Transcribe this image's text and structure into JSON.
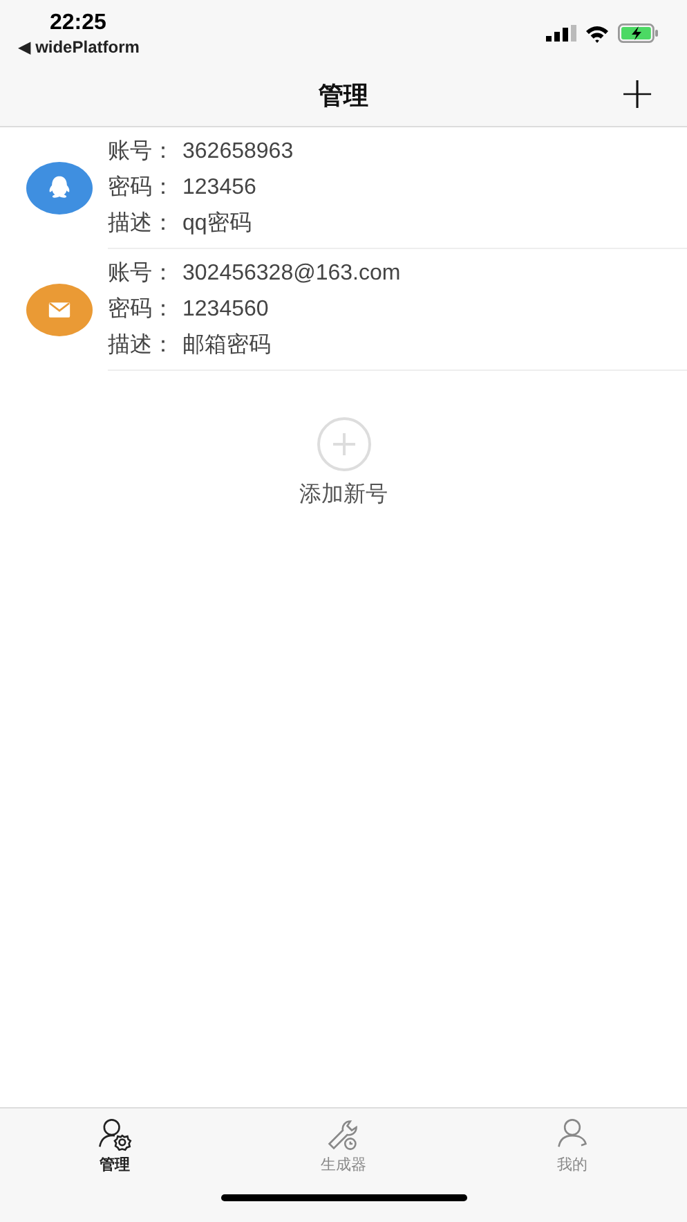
{
  "status_bar": {
    "time": "22:25",
    "back_label": "◀ widePlatform"
  },
  "nav": {
    "title": "管理",
    "action": "+"
  },
  "accounts": [
    {
      "kind": "qq",
      "color": "#3f8fe0",
      "fields": [
        {
          "label": "账号：",
          "value": "362658963"
        },
        {
          "label": "密码：",
          "value": "123456"
        },
        {
          "label": "描述：",
          "value": "qq密码"
        }
      ]
    },
    {
      "kind": "mail",
      "color": "#ea9a35",
      "fields": [
        {
          "label": "账号：",
          "value": "302456328@163.com"
        },
        {
          "label": "密码：",
          "value": "1234560"
        },
        {
          "label": "描述：",
          "value": "邮箱密码"
        }
      ]
    }
  ],
  "add_button": {
    "label": "添加新号"
  },
  "tabs": [
    {
      "kind": "manage",
      "label": "管理",
      "selected": true
    },
    {
      "kind": "generator",
      "label": "生成器",
      "selected": false
    },
    {
      "kind": "profile",
      "label": "我的",
      "selected": false
    }
  ]
}
